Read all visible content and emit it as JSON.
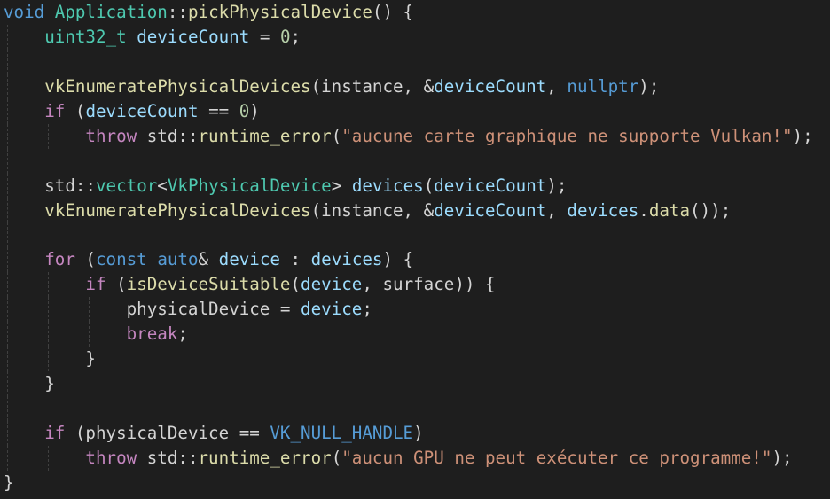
{
  "editor": {
    "theme": {
      "background": "#1e1e1e",
      "text": "#d4d4d4"
    },
    "lines": [
      {
        "indent": 0,
        "tokens": [
          {
            "t": "void",
            "c": "kw"
          },
          {
            "t": " ",
            "c": "pl"
          },
          {
            "t": "Application",
            "c": "type"
          },
          {
            "t": "::",
            "c": "pl"
          },
          {
            "t": "pickPhysicalDevice",
            "c": "fn"
          },
          {
            "t": "() {",
            "c": "pl"
          }
        ]
      },
      {
        "indent": 1,
        "tokens": [
          {
            "t": "uint32_t",
            "c": "type"
          },
          {
            "t": " ",
            "c": "pl"
          },
          {
            "t": "deviceCount",
            "c": "var"
          },
          {
            "t": " = ",
            "c": "pl"
          },
          {
            "t": "0",
            "c": "num"
          },
          {
            "t": ";",
            "c": "pl"
          }
        ]
      },
      {
        "indent": 1,
        "tokens": []
      },
      {
        "indent": 1,
        "tokens": [
          {
            "t": "vkEnumeratePhysicalDevices",
            "c": "fn"
          },
          {
            "t": "(instance, &",
            "c": "pl"
          },
          {
            "t": "deviceCount",
            "c": "var"
          },
          {
            "t": ", ",
            "c": "pl"
          },
          {
            "t": "nullptr",
            "c": "kw"
          },
          {
            "t": ");",
            "c": "pl"
          }
        ]
      },
      {
        "indent": 1,
        "tokens": [
          {
            "t": "if",
            "c": "ctl"
          },
          {
            "t": " (",
            "c": "pl"
          },
          {
            "t": "deviceCount",
            "c": "var"
          },
          {
            "t": " == ",
            "c": "pl"
          },
          {
            "t": "0",
            "c": "num"
          },
          {
            "t": ")",
            "c": "pl"
          }
        ]
      },
      {
        "indent": 2,
        "tokens": [
          {
            "t": "throw",
            "c": "ctl"
          },
          {
            "t": " std::",
            "c": "pl"
          },
          {
            "t": "runtime_error",
            "c": "fn"
          },
          {
            "t": "(",
            "c": "pl"
          },
          {
            "t": "\"aucune carte graphique ne supporte Vulkan!\"",
            "c": "str"
          },
          {
            "t": ");",
            "c": "pl"
          }
        ]
      },
      {
        "indent": 1,
        "tokens": []
      },
      {
        "indent": 1,
        "tokens": [
          {
            "t": "std::",
            "c": "pl"
          },
          {
            "t": "vector",
            "c": "type"
          },
          {
            "t": "<",
            "c": "pl"
          },
          {
            "t": "VkPhysicalDevice",
            "c": "type"
          },
          {
            "t": "> ",
            "c": "pl"
          },
          {
            "t": "devices",
            "c": "var"
          },
          {
            "t": "(",
            "c": "pl"
          },
          {
            "t": "deviceCount",
            "c": "var"
          },
          {
            "t": ");",
            "c": "pl"
          }
        ]
      },
      {
        "indent": 1,
        "tokens": [
          {
            "t": "vkEnumeratePhysicalDevices",
            "c": "fn"
          },
          {
            "t": "(instance, &",
            "c": "pl"
          },
          {
            "t": "deviceCount",
            "c": "var"
          },
          {
            "t": ", ",
            "c": "pl"
          },
          {
            "t": "devices",
            "c": "var"
          },
          {
            "t": ".",
            "c": "pl"
          },
          {
            "t": "data",
            "c": "fn"
          },
          {
            "t": "());",
            "c": "pl"
          }
        ]
      },
      {
        "indent": 1,
        "tokens": []
      },
      {
        "indent": 1,
        "tokens": [
          {
            "t": "for",
            "c": "ctl"
          },
          {
            "t": " (",
            "c": "pl"
          },
          {
            "t": "const",
            "c": "kw"
          },
          {
            "t": " ",
            "c": "pl"
          },
          {
            "t": "auto",
            "c": "kw"
          },
          {
            "t": "& ",
            "c": "pl"
          },
          {
            "t": "device",
            "c": "var"
          },
          {
            "t": " : ",
            "c": "pl"
          },
          {
            "t": "devices",
            "c": "var"
          },
          {
            "t": ") {",
            "c": "pl"
          }
        ]
      },
      {
        "indent": 2,
        "tokens": [
          {
            "t": "if",
            "c": "ctl"
          },
          {
            "t": " (",
            "c": "pl"
          },
          {
            "t": "isDeviceSuitable",
            "c": "fn"
          },
          {
            "t": "(",
            "c": "pl"
          },
          {
            "t": "device",
            "c": "var"
          },
          {
            "t": ", surface)) {",
            "c": "pl"
          }
        ]
      },
      {
        "indent": 3,
        "tokens": [
          {
            "t": "physicalDevice = ",
            "c": "pl"
          },
          {
            "t": "device",
            "c": "var"
          },
          {
            "t": ";",
            "c": "pl"
          }
        ]
      },
      {
        "indent": 3,
        "tokens": [
          {
            "t": "break",
            "c": "ctl"
          },
          {
            "t": ";",
            "c": "pl"
          }
        ]
      },
      {
        "indent": 2,
        "tokens": [
          {
            "t": "}",
            "c": "pl"
          }
        ]
      },
      {
        "indent": 1,
        "tokens": [
          {
            "t": "}",
            "c": "pl"
          }
        ]
      },
      {
        "indent": 1,
        "tokens": []
      },
      {
        "indent": 1,
        "tokens": [
          {
            "t": "if",
            "c": "ctl"
          },
          {
            "t": " (physicalDevice == ",
            "c": "pl"
          },
          {
            "t": "VK_NULL_HANDLE",
            "c": "mac"
          },
          {
            "t": ")",
            "c": "pl"
          }
        ]
      },
      {
        "indent": 2,
        "tokens": [
          {
            "t": "throw",
            "c": "ctl"
          },
          {
            "t": " std::",
            "c": "pl"
          },
          {
            "t": "runtime_error",
            "c": "fn"
          },
          {
            "t": "(",
            "c": "pl"
          },
          {
            "t": "\"aucun GPU ne peut exécuter ce programme!\"",
            "c": "str"
          },
          {
            "t": ");",
            "c": "pl"
          }
        ]
      },
      {
        "indent": 0,
        "tokens": [
          {
            "t": "}",
            "c": "pl"
          }
        ]
      }
    ]
  }
}
